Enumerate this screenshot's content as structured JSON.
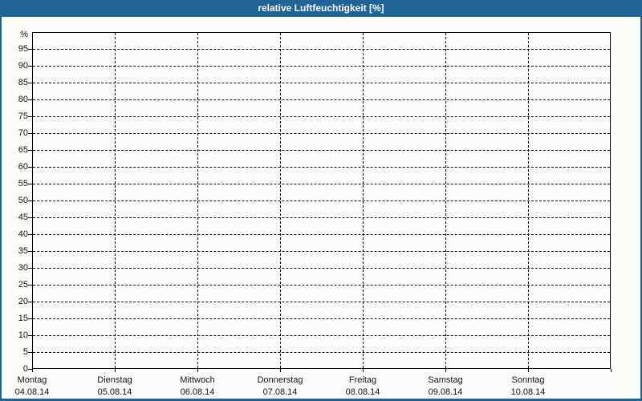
{
  "window": {
    "title": "relative Luftfeuchtigkeit [%]"
  },
  "colors": {
    "frame_blue": "#1f6497",
    "background": "#fdfdf8",
    "grid": "#000000",
    "label_text": "#111111",
    "title_text": "#ffffff"
  },
  "chart_data": {
    "type": "line",
    "title": "relative Luftfeuchtigkeit [%]",
    "xlabel": "",
    "ylabel": "%",
    "ylim": [
      0,
      100
    ],
    "yticks": [
      0,
      5,
      10,
      15,
      20,
      25,
      30,
      35,
      40,
      45,
      50,
      55,
      60,
      65,
      70,
      75,
      80,
      85,
      90,
      95
    ],
    "grid": "dashed",
    "legend": "none",
    "categories": [
      "Montag",
      "Dienstag",
      "Mittwoch",
      "Donnerstag",
      "Freitag",
      "Samstag",
      "Sonntag"
    ],
    "category_dates": [
      "04.08.14",
      "05.08.14",
      "06.08.14",
      "07.08.14",
      "08.08.14",
      "09.08.14",
      "10.08.14"
    ],
    "series": []
  }
}
